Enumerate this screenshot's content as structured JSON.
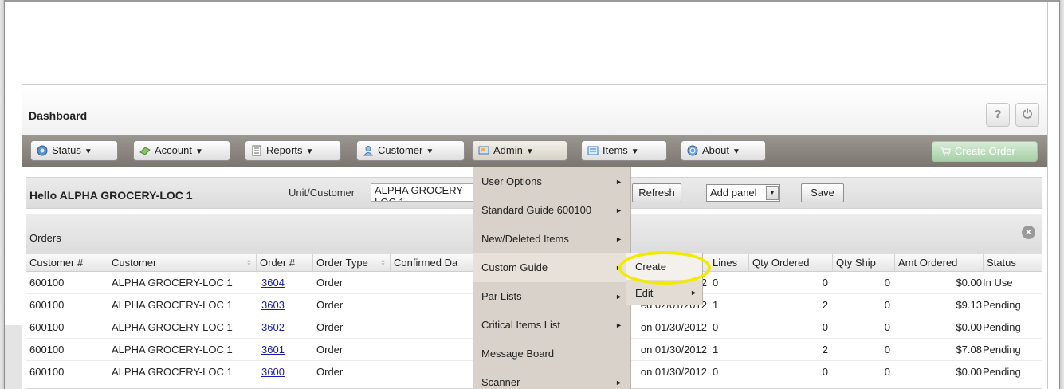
{
  "header": {
    "title": "Dashboard",
    "help_glyph": "?",
    "power_glyph": "⏻"
  },
  "toolbar": {
    "items": [
      {
        "label": "Status",
        "icon": "status-icon"
      },
      {
        "label": "Account",
        "icon": "account-icon"
      },
      {
        "label": "Reports",
        "icon": "reports-icon"
      },
      {
        "label": "Customer",
        "icon": "customer-icon"
      },
      {
        "label": "Admin",
        "icon": "admin-icon"
      },
      {
        "label": "Items",
        "icon": "items-icon"
      },
      {
        "label": "About",
        "icon": "about-icon"
      }
    ],
    "dropdown_arrow": "▼",
    "create_order": "Create Order"
  },
  "hello_bar": {
    "greeting": "Hello ALPHA GROCERY-LOC 1",
    "unit_customer_label": "Unit/Customer",
    "unit_customer_value": "ALPHA GROCERY-LOC 1",
    "refresh": "Refresh",
    "add_panel": "Add panel",
    "save": "Save"
  },
  "orders": {
    "title": "Orders",
    "close_glyph": "×",
    "columns": [
      "Customer #",
      "Customer",
      "Order #",
      "Order Type",
      "Confirmed Da",
      "Lines",
      "Qty Ordered",
      "Qty Ship",
      "Amt Ordered",
      "Status"
    ],
    "rows": [
      {
        "customer_no": "600100",
        "customer": "ALPHA GROCERY-LOC 1",
        "order_no": "3604",
        "order_type": "Order",
        "date_frag": "2",
        "lines": "0",
        "qty_ordered": "0",
        "qty_ship": "0",
        "amt": "$0.00",
        "status": "In Use"
      },
      {
        "customer_no": "600100",
        "customer": "ALPHA GROCERY-LOC 1",
        "order_no": "3603",
        "order_type": "Order",
        "date_frag": "ed 02/01/2012",
        "lines": "1",
        "qty_ordered": "2",
        "qty_ship": "0",
        "amt": "$9.13",
        "status": "Pending"
      },
      {
        "customer_no": "600100",
        "customer": "ALPHA GROCERY-LOC 1",
        "order_no": "3602",
        "order_type": "Order",
        "date_frag": "on 01/30/2012",
        "lines": "0",
        "qty_ordered": "0",
        "qty_ship": "0",
        "amt": "$0.00",
        "status": "Pending"
      },
      {
        "customer_no": "600100",
        "customer": "ALPHA GROCERY-LOC 1",
        "order_no": "3601",
        "order_type": "Order",
        "date_frag": "on 01/30/2012",
        "lines": "1",
        "qty_ordered": "2",
        "qty_ship": "0",
        "amt": "$7.08",
        "status": "Pending"
      },
      {
        "customer_no": "600100",
        "customer": "ALPHA GROCERY-LOC 1",
        "order_no": "3600",
        "order_type": "Order",
        "date_frag": "on 01/30/2012",
        "lines": "0",
        "qty_ordered": "0",
        "qty_ship": "0",
        "amt": "$0.00",
        "status": "Pending"
      }
    ]
  },
  "admin_menu": {
    "items": [
      {
        "label": "User Options",
        "has_sub": true
      },
      {
        "label": "Standard Guide 600100",
        "has_sub": true
      },
      {
        "label": "New/Deleted Items",
        "has_sub": true
      },
      {
        "label": "Custom Guide",
        "has_sub": true
      },
      {
        "label": "Par Lists",
        "has_sub": true
      },
      {
        "label": "Critical Items List",
        "has_sub": true
      },
      {
        "label": "Message Board",
        "has_sub": false
      },
      {
        "label": "Scanner",
        "has_sub": true
      }
    ],
    "sub_arrow": "►"
  },
  "custom_guide_submenu": {
    "items": [
      {
        "label": "Create",
        "has_sub": false
      },
      {
        "label": "Edit",
        "has_sub": true
      }
    ]
  }
}
